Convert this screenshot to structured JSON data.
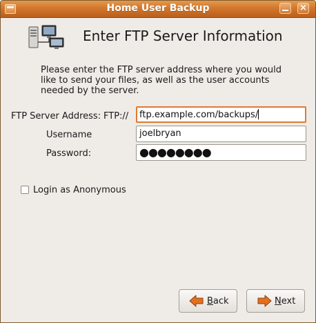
{
  "window": {
    "title": "Home User Backup",
    "controls": {
      "minimize": "minimize-button",
      "close": "×"
    }
  },
  "header": {
    "heading": "Enter FTP Server Information",
    "icon": "network-computers-icon"
  },
  "description": "Please enter the FTP server address where you would like to send your files, as well as the user accounts needed by the server.",
  "form": {
    "server_label": "FTP Server Address:",
    "server_prefix": "FTP://",
    "server_value": "ftp.example.com/backups/",
    "username_label": "Username",
    "username_value": "joelbryan",
    "password_label": "Password:",
    "password_value": "●●●●●●●●"
  },
  "anonymous": {
    "label": "Login as Anonymous",
    "checked": false
  },
  "buttons": {
    "back_label": "Back",
    "back_mnemonic": "B",
    "back_rest": "ack",
    "next_label": "Next",
    "next_mnemonic": "N",
    "next_rest": "ext"
  },
  "colors": {
    "titlebar": "#d2772c",
    "focus_border": "#de7b31",
    "arrow": "#e2711f",
    "background": "#efebe7"
  }
}
